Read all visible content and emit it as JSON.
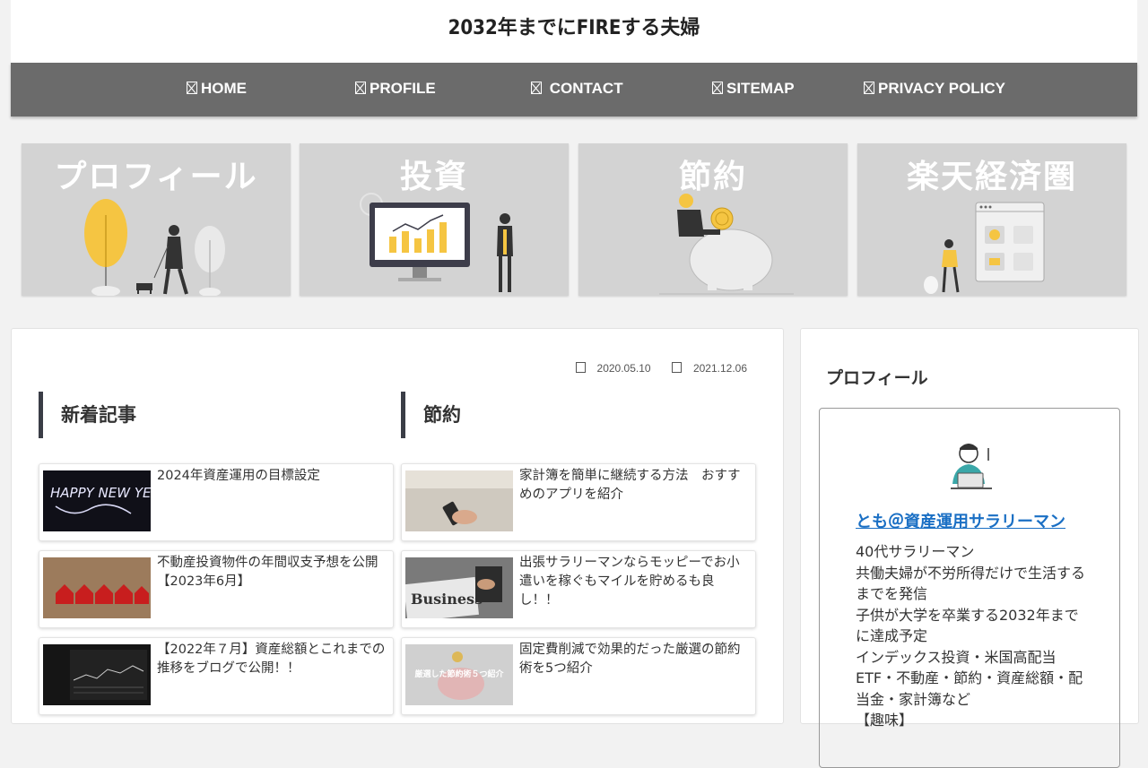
{
  "header": {
    "site_title": "2032年までにFIREする夫婦"
  },
  "nav": {
    "items": [
      {
        "label": "HOME",
        "icon": "home-icon"
      },
      {
        "label": "PROFILE",
        "icon": "user-icon"
      },
      {
        "label": "CONTACT",
        "icon": "mail-icon"
      },
      {
        "label": "SITEMAP",
        "icon": "sitemap-icon"
      },
      {
        "label": "PRIVACY POLICY",
        "icon": "shield-icon"
      }
    ]
  },
  "categories": [
    {
      "title": "プロフィール"
    },
    {
      "title": "投資"
    },
    {
      "title": "節約"
    },
    {
      "title": "楽天経済圏"
    }
  ],
  "post_meta": {
    "published": "2020.05.10",
    "updated": "2021.12.06"
  },
  "sections": {
    "left": {
      "heading": "新着記事",
      "articles": [
        {
          "title": "2024年資産運用の目標設定"
        },
        {
          "title": "不動産投資物件の年間収支予想を公開【2023年6月】"
        },
        {
          "title": "【2022年７月】資産総額とこれまでの推移をブログで公開！！"
        }
      ]
    },
    "right": {
      "heading": "節約",
      "articles": [
        {
          "title": "家計簿を簡単に継続する方法　おすすめのアプリを紹介"
        },
        {
          "title": "出張サラリーマンならモッピーでお小遣いを稼ぐもマイルを貯めるも良し！！"
        },
        {
          "title": "固定費削減で効果的だった厳選の節約術を5つ紹介"
        }
      ]
    }
  },
  "thumb_text": {
    "happy": "HAPPY NEW YEAR",
    "business": "Business",
    "savings": "厳選した節約術５つ紹介"
  },
  "sidebar": {
    "title": "プロフィール",
    "profile_name": "とも＠資産運用サラリーマン",
    "description_lines": [
      "40代サラリーマン",
      "共働夫婦が不労所得だけで生活するまでを発信",
      "子供が大学を卒業する2032年までに達成予定",
      "インデックス投資・米国高配当ETF・不動産・節約・資産総額・配当金・家計簿など",
      "【趣味】"
    ]
  }
}
